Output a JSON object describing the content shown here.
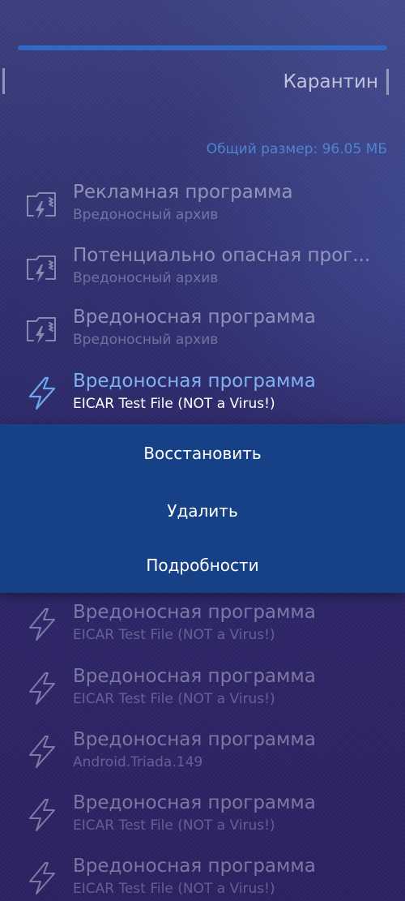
{
  "header": {
    "title": "Карантин",
    "progress_fraction": 1.0
  },
  "summary": {
    "total_size": "Общий размер: 96.05 МБ"
  },
  "items": [
    {
      "name": "Рекламная программа",
      "sub": "Вредоносный архив",
      "icon": "archive-threat-icon"
    },
    {
      "name": "Потенциально опасная прог...",
      "sub": "Вредоносный архив",
      "icon": "archive-threat-icon"
    },
    {
      "name": "Вредоносная программа",
      "sub": "Вредоносный архив",
      "icon": "archive-threat-icon"
    },
    {
      "name": "Вредоносная программа",
      "sub": "EICAR Test File (NOT a Virus!)",
      "icon": "lightning-icon",
      "selected": true
    },
    {
      "name": "Вредоносная программа",
      "sub": "EICAR Test File (NOT a Virus!)",
      "icon": "lightning-icon"
    },
    {
      "name": "Вредоносная программа",
      "sub": "EICAR Test File (NOT a Virus!)",
      "icon": "lightning-icon"
    },
    {
      "name": "Вредоносная программа",
      "sub": "Android.Triada.149",
      "icon": "lightning-icon"
    },
    {
      "name": "Вредоносная программа",
      "sub": "EICAR Test File (NOT a Virus!)",
      "icon": "lightning-icon"
    },
    {
      "name": "Вредоносная программа",
      "sub": "EICAR Test File (NOT a Virus!)",
      "icon": "lightning-icon"
    }
  ],
  "context_menu": {
    "restore": "Восстановить",
    "delete": "Удалить",
    "details": "Подробности"
  },
  "colors": {
    "accent": "#2f67c4",
    "menu_bg": "#164187",
    "selected_name": "#7bb2f2",
    "size_text": "#4f82d0"
  }
}
